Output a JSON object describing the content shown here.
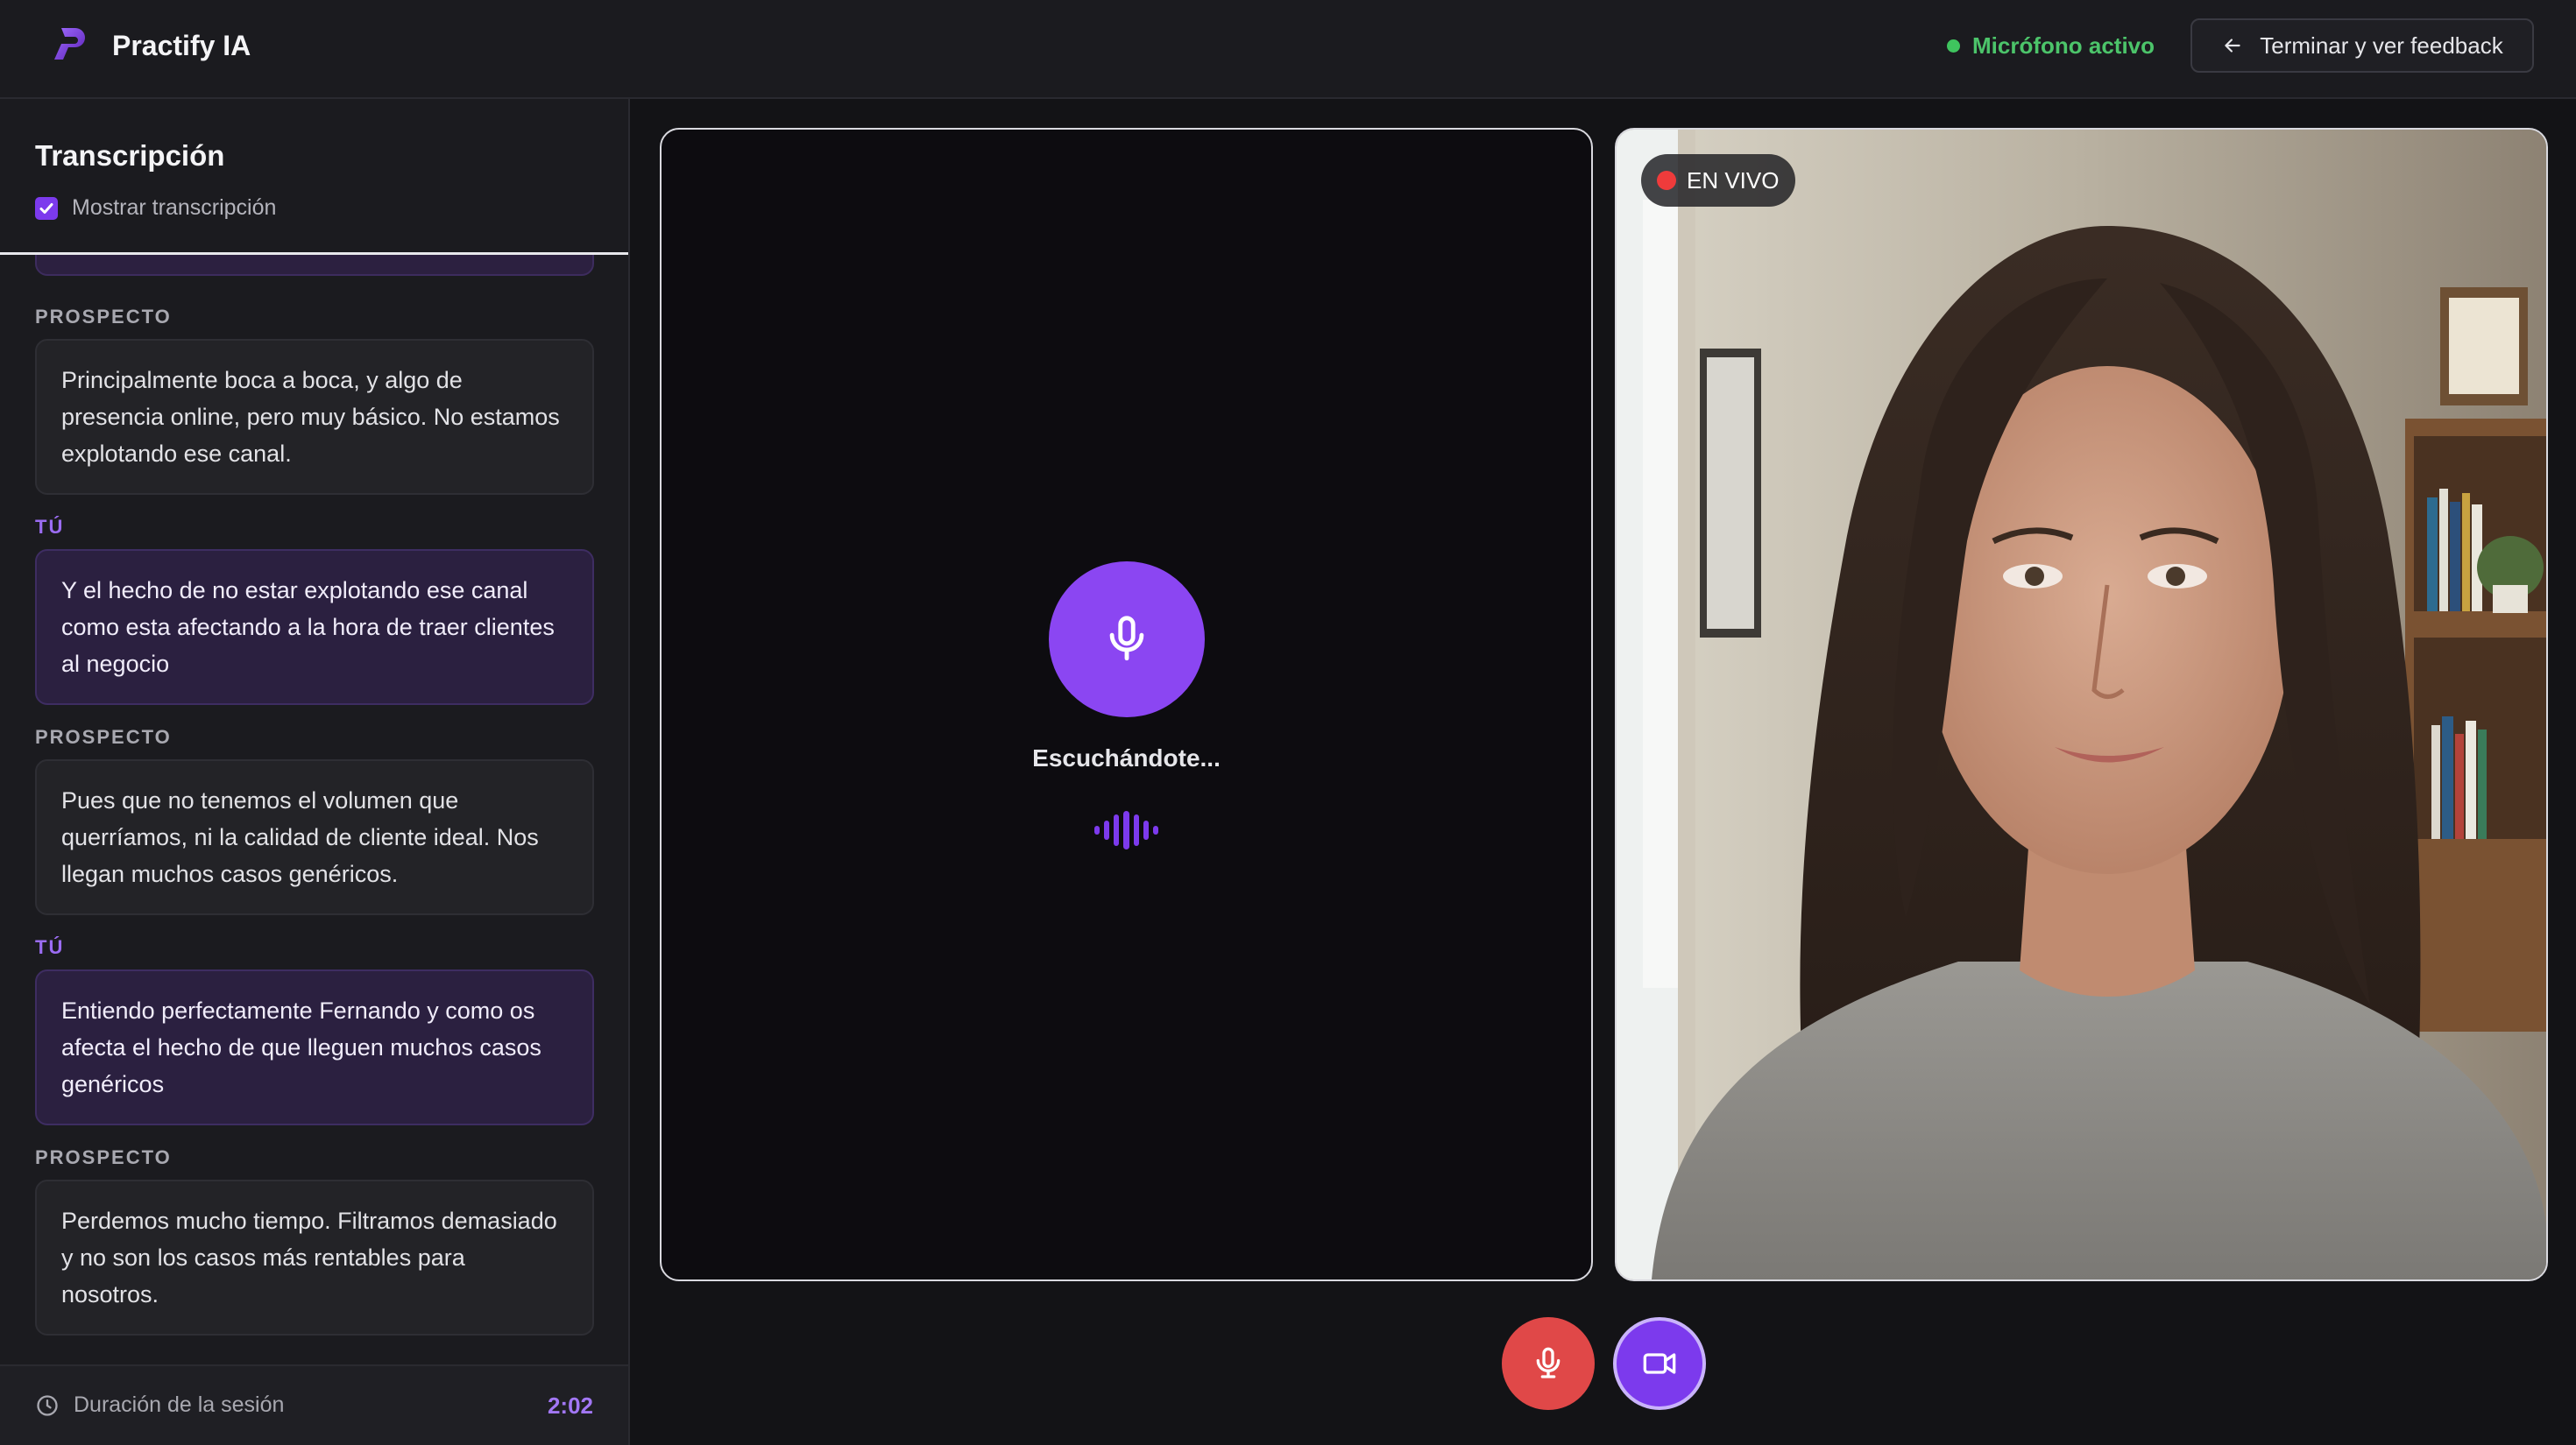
{
  "app": {
    "title": "Practify IA",
    "brand_color": "#7c3aed"
  },
  "header": {
    "mic_status": "Micrófono activo",
    "mic_status_color": "#3fc45e",
    "end_button_label": "Terminar y ver feedback",
    "end_button_icon": "arrow-left-icon"
  },
  "sidebar": {
    "title": "Transcripción",
    "toggle_label": "Mostrar transcripción",
    "toggle_checked": true,
    "messages": [
      {
        "role": "PROSPECTO",
        "text": "Principalmente boca a boca, y algo de presencia online, pero muy básico. No estamos explotando ese canal."
      },
      {
        "role": "TÚ",
        "text": "Y el hecho de no estar explotando ese canal como esta afectando a la hora de traer clientes al negocio"
      },
      {
        "role": "PROSPECTO",
        "text": "Pues que no tenemos el volumen que querríamos, ni la calidad de cliente ideal. Nos llegan muchos casos genéricos."
      },
      {
        "role": "TÚ",
        "text": "Entiendo perfectamente Fernando y como os afecta el hecho de que lleguen muchos casos genéricos"
      },
      {
        "role": "PROSPECTO",
        "text": "Perdemos mucho tiempo. Filtramos demasiado y no son los casos más rentables para nosotros."
      }
    ],
    "duration_label": "Duración de la sesión",
    "duration_value": "2:02"
  },
  "agent": {
    "status": "Escuchándote...",
    "icon": "microphone-icon"
  },
  "video": {
    "live_label": "EN VIVO",
    "live_color": "#ef3b3b"
  },
  "controls": {
    "mic_icon": "microphone-icon",
    "mic_color": "#e04848",
    "camera_icon": "video-camera-icon",
    "camera_color": "#7c3aed"
  }
}
